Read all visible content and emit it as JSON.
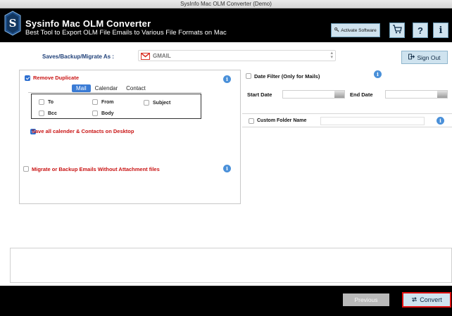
{
  "window": {
    "title": "SysInfo Mac OLM Converter (Demo)"
  },
  "header": {
    "app_name": "Sysinfo Mac OLM Converter",
    "tagline": "Best Tool to Export OLM File Emails to Various File Formats on Mac",
    "activate_label": "Activate Software",
    "cart_icon": "cart-icon",
    "help_icon": "help-icon",
    "info_icon": "info-icon"
  },
  "save_as": {
    "label": "Saves/Backup/Migrate As :",
    "selected_format": "GMAIL",
    "format_icon": "gmail-icon"
  },
  "signout_label": "Sign Out",
  "options": {
    "remove_duplicate": {
      "label": "Remove Duplicate",
      "checked": true
    },
    "tabs": [
      {
        "label": "Mail",
        "active": true
      },
      {
        "label": "Calendar",
        "active": false
      },
      {
        "label": "Contact",
        "active": false
      }
    ],
    "mail_fields": [
      {
        "label": "To",
        "checked": false
      },
      {
        "label": "From",
        "checked": false
      },
      {
        "label": "Subject",
        "checked": false
      },
      {
        "label": "Bcc",
        "checked": false
      },
      {
        "label": "Body",
        "checked": false
      }
    ],
    "save_calendar_contacts": {
      "label": "Save all calender & Contacts on Desktop",
      "checked": true
    },
    "without_attachments": {
      "label": "Migrate or Backup Emails Without Attachment files",
      "checked": false
    }
  },
  "filters": {
    "date_filter_label": "Date Filter  (Only for Mails)",
    "start_date_label": "Start Date",
    "end_date_label": "End Date",
    "custom_folder_label": "Custom Folder Name"
  },
  "footer": {
    "previous_label": "Previous",
    "convert_label": "Convert"
  },
  "colors": {
    "header_bg": "#000000",
    "accent_button": "#cfe3ef",
    "active_tab": "#3a7bd5",
    "warning_text": "#c91313",
    "convert_highlight": "#e01010"
  }
}
